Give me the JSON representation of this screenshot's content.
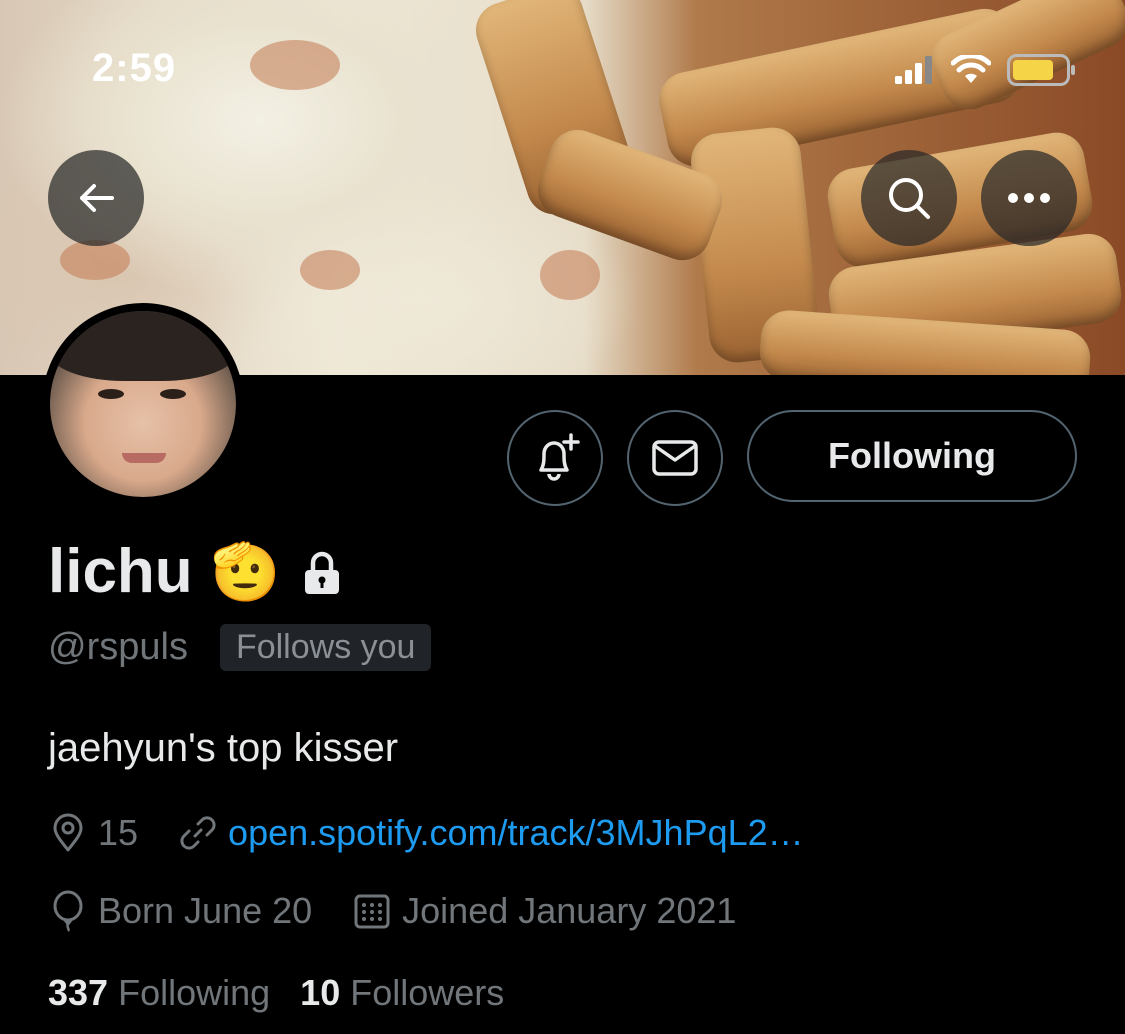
{
  "status_bar": {
    "time": "2:59"
  },
  "banner": {
    "image": "food banner (fries and cream sauce)"
  },
  "profile": {
    "name": "lichu",
    "emoji": "🫡",
    "handle": "@rspuls",
    "follows_you": "Follows you",
    "bio": "jaehyun's top kisser",
    "location": "15",
    "website": "open.spotify.com/track/3MJhPqL2…",
    "birthday": "Born June 20",
    "joined": "Joined January 2021",
    "following_count": "337",
    "following_label": "Following",
    "followers_count": "10",
    "followers_label": "Followers"
  },
  "actions": {
    "follow_state": "Following"
  },
  "icons": {
    "back": "arrow-left-icon",
    "search": "search-icon",
    "more": "more-icon",
    "notify": "bell-plus-icon",
    "message": "envelope-icon",
    "location": "location-pin-icon",
    "link": "link-icon",
    "birthday": "balloon-icon",
    "calendar": "calendar-icon",
    "lock": "lock-icon"
  },
  "colors": {
    "accent": "#1d9bf0",
    "background": "#000000",
    "muted": "#71767b",
    "battery": "#f5d547"
  }
}
